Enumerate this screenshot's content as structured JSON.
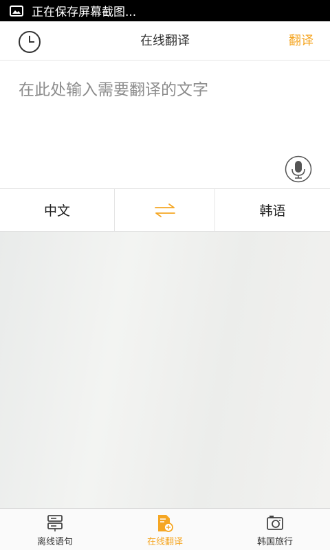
{
  "statusbar": {
    "notification_text": "正在保存屏幕截图..."
  },
  "header": {
    "history_icon": "clock-icon",
    "title": "在线翻译",
    "translate_label": "翻译"
  },
  "input": {
    "placeholder": "在此处输入需要翻译的文字",
    "value": "",
    "mic_icon": "microphone-icon"
  },
  "languages": {
    "source": "中文",
    "target": "韩语",
    "swap_icon": "swap-arrows-icon"
  },
  "bottom_nav": {
    "items": [
      {
        "label": "离线语句",
        "icon": "phrasebook-icon",
        "active": false
      },
      {
        "label": "在线翻译",
        "icon": "translate-doc-icon",
        "active": true
      },
      {
        "label": "韩国旅行",
        "icon": "camera-icon",
        "active": false
      }
    ]
  },
  "colors": {
    "accent": "#f5a623",
    "statusbar": "#000000"
  }
}
